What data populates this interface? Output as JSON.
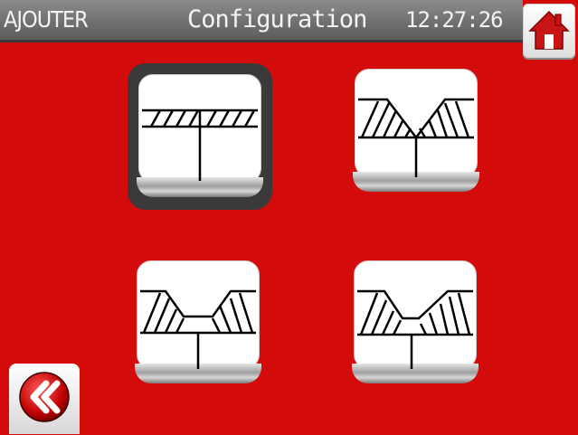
{
  "header": {
    "mode_label": "AJOUTER",
    "title": "Configuration",
    "time": "12:27:26"
  },
  "icons": {
    "home": "home-icon",
    "back": "double-chevron-left-icon"
  },
  "colors": {
    "background": "#d40b0b",
    "topbar": "#737373",
    "selected_border": "#3a3a3a"
  },
  "tiles": [
    {
      "name": "joint-flat-t",
      "selected": true
    },
    {
      "name": "joint-v-groove",
      "selected": false
    },
    {
      "name": "joint-u-groove",
      "selected": false
    },
    {
      "name": "joint-y-groove",
      "selected": false
    }
  ]
}
